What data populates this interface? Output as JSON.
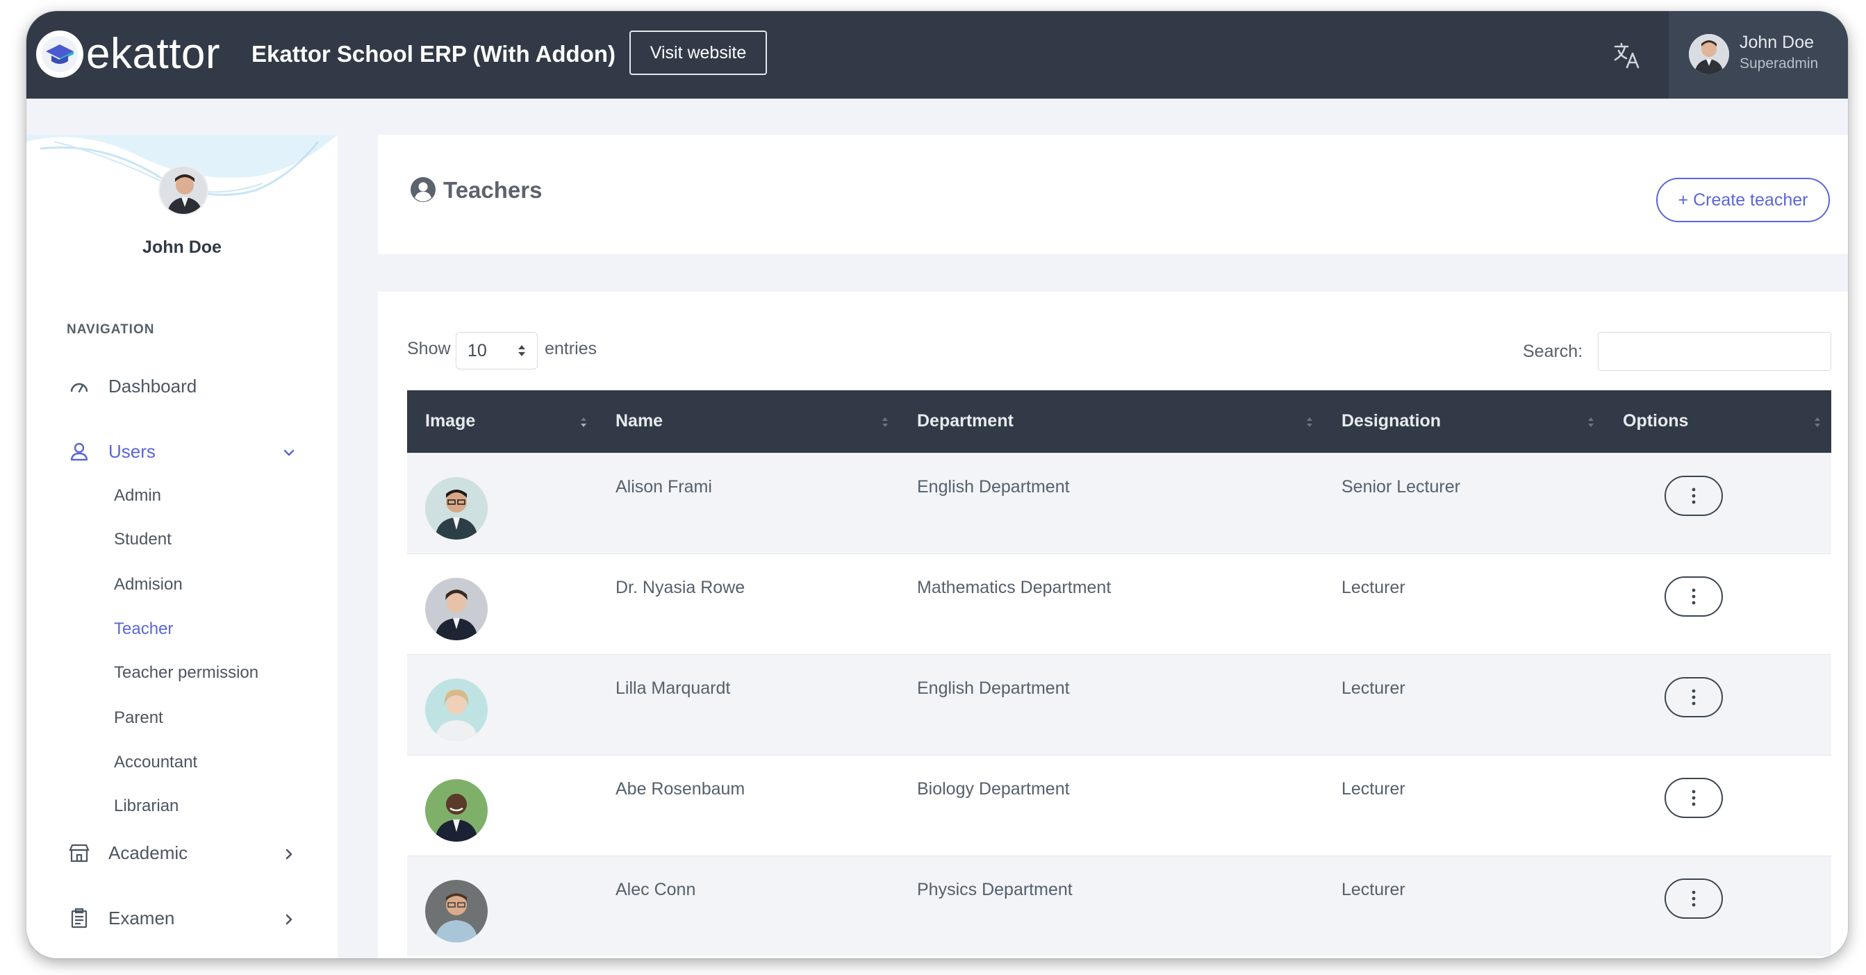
{
  "topbar": {
    "logo_text": "ekattor",
    "app_title": "Ekattor School ERP (With Addon)",
    "visit_label": "Visit website",
    "translate_icon": "translate-icon",
    "user": {
      "name": "John Doe",
      "role": "Superadmin"
    }
  },
  "sidebar": {
    "profile_name": "John Doe",
    "nav_title": "NAVIGATION",
    "items": {
      "dashboard": "Dashboard",
      "users": "Users",
      "academic": "Academic",
      "examen": "Examen"
    },
    "users_sub": [
      "Admin",
      "Student",
      "Admision",
      "Teacher",
      "Teacher permission",
      "Parent",
      "Accountant",
      "Librarian"
    ],
    "active_sub": "Teacher"
  },
  "page": {
    "title": "Teachers",
    "create_label": "+ Create teacher"
  },
  "table_controls": {
    "show_label": "Show",
    "page_length": "10",
    "entries_label": "entries",
    "search_label": "Search:",
    "search_value": ""
  },
  "table": {
    "columns": [
      "Image",
      "Name",
      "Department",
      "Designation",
      "Options"
    ],
    "rows": [
      {
        "name": "Alison Frami",
        "department": "English Department",
        "designation": "Senior Lecturer"
      },
      {
        "name": "Dr. Nyasia Rowe",
        "department": "Mathematics Department",
        "designation": "Lecturer"
      },
      {
        "name": "Lilla Marquardt",
        "department": "English Department",
        "designation": "Lecturer"
      },
      {
        "name": "Abe Rosenbaum",
        "department": "Biology Department",
        "designation": "Lecturer"
      },
      {
        "name": "Alec Conn",
        "department": "Physics Department",
        "designation": "Lecturer"
      }
    ]
  },
  "colors": {
    "topbar": "#313a46",
    "accent": "#5a67d8",
    "page_bg": "#f2f3f8"
  }
}
